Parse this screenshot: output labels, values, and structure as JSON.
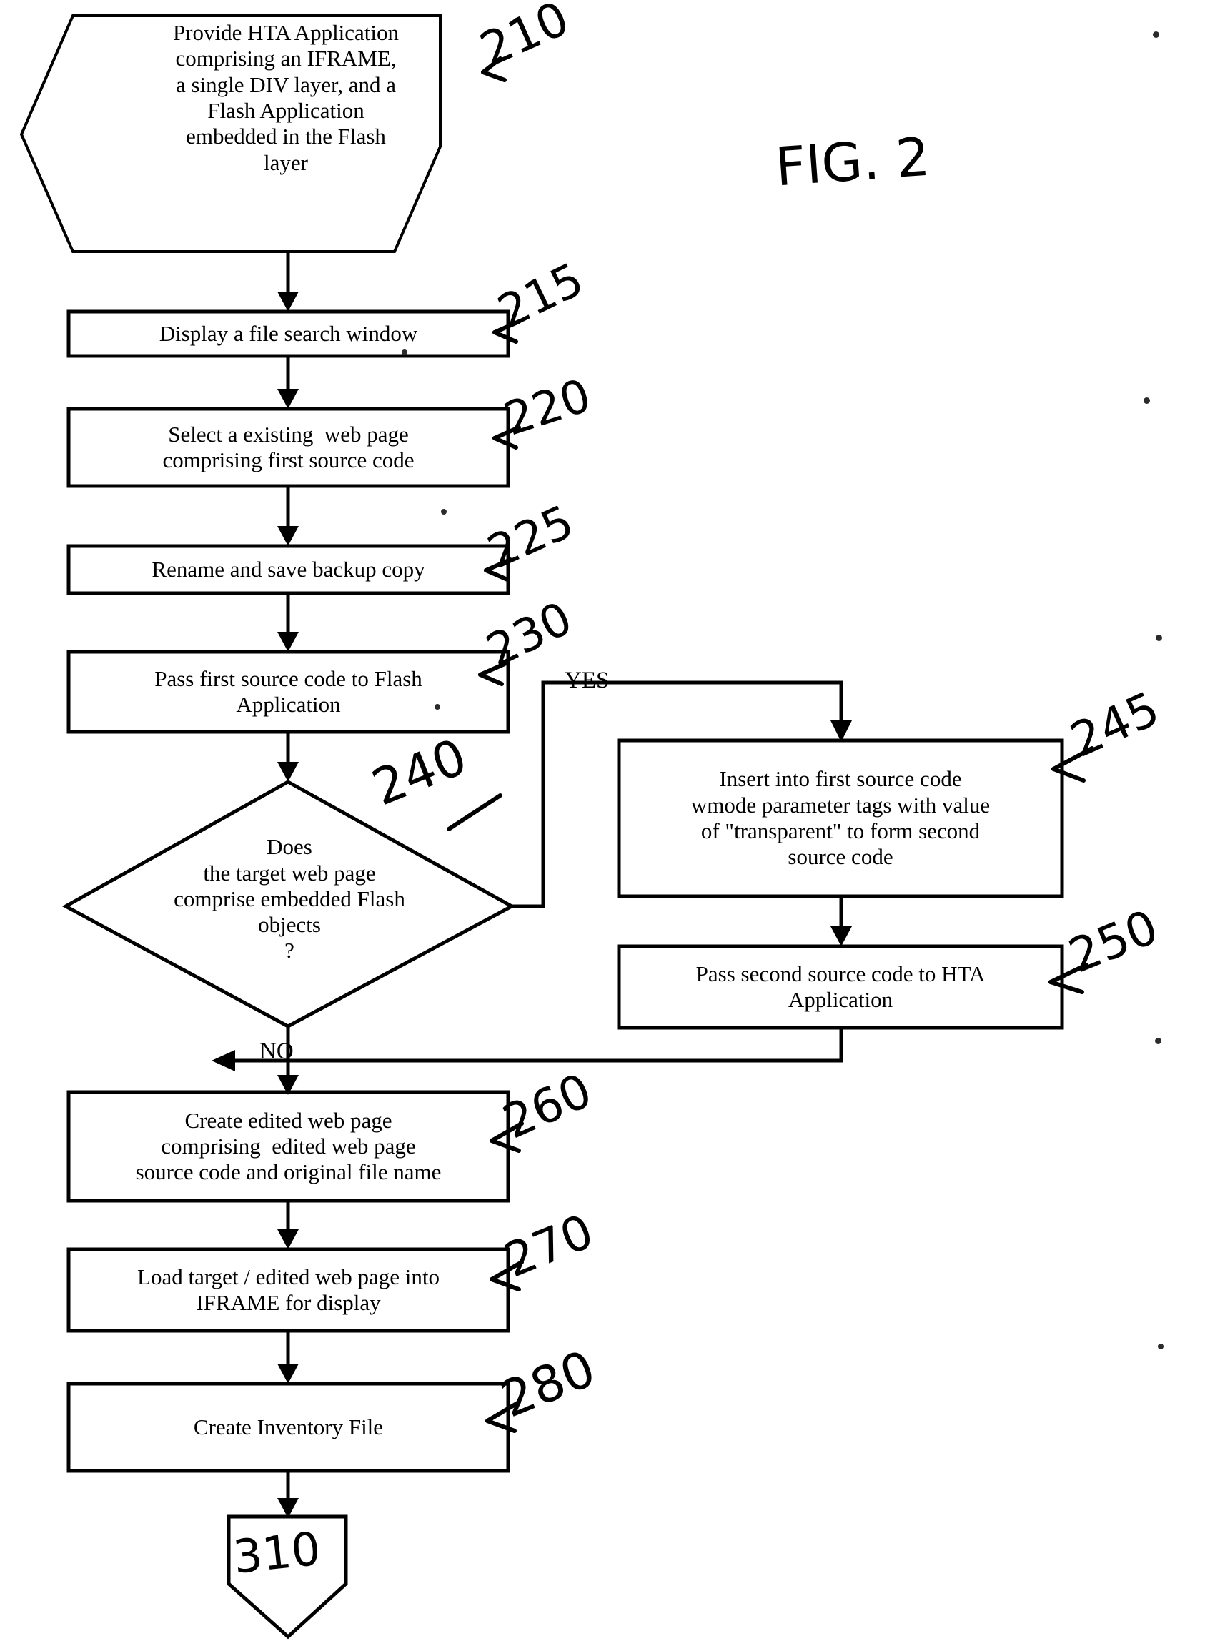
{
  "figure": {
    "title": "FIG. 2",
    "type": "patent-flowchart"
  },
  "nodes": [
    {
      "id": "210",
      "shape": "hexagon",
      "ref": "210",
      "lines": [
        "Provide HTA Application",
        "comprising an IFRAME,",
        "a single DIV layer, and a",
        "Flash Application",
        "embedded in the Flash",
        "layer"
      ]
    },
    {
      "id": "215",
      "shape": "process",
      "ref": "215",
      "lines": [
        "Display a file search window"
      ]
    },
    {
      "id": "220",
      "shape": "process",
      "ref": "220",
      "lines": [
        "Select a existing  web page",
        "comprising first source code"
      ]
    },
    {
      "id": "225",
      "shape": "process",
      "ref": "225",
      "lines": [
        "Rename and save backup copy"
      ]
    },
    {
      "id": "230",
      "shape": "process",
      "ref": "230",
      "lines": [
        "Pass first source code to Flash",
        "Application"
      ]
    },
    {
      "id": "240",
      "shape": "decision",
      "ref": "240",
      "lines": [
        "Does",
        "the target web page",
        "comprise embedded Flash",
        "objects",
        "?"
      ]
    },
    {
      "id": "245",
      "shape": "process",
      "ref": "245",
      "lines": [
        "Insert into first source code",
        "wmode parameter tags with value",
        "of \"transparent\" to form second",
        "source code"
      ]
    },
    {
      "id": "250",
      "shape": "process",
      "ref": "250",
      "lines": [
        "Pass second source code to HTA",
        "Application"
      ]
    },
    {
      "id": "260",
      "shape": "process",
      "ref": "260",
      "lines": [
        "Create edited web page",
        "comprising  edited web page",
        "source code and original file name"
      ]
    },
    {
      "id": "270",
      "shape": "process",
      "ref": "270",
      "lines": [
        "Load target / edited web page into",
        "IFRAME for display"
      ]
    },
    {
      "id": "280",
      "shape": "process",
      "ref": "280",
      "lines": [
        "Create Inventory File"
      ]
    },
    {
      "id": "310",
      "shape": "terminator",
      "ref": "310",
      "lines": []
    }
  ],
  "branch_labels": {
    "yes": "YES",
    "no": "NO"
  },
  "refs": {
    "n210": "210",
    "n215": "215",
    "n220": "220",
    "n225": "225",
    "n230": "230",
    "n240": "240",
    "n245": "245",
    "n250": "250",
    "n260": "260",
    "n270": "270",
    "n280": "280",
    "n310": "310"
  },
  "text": {
    "hex210_l1": "Provide HTA Application",
    "hex210_l2": "comprising an IFRAME,",
    "hex210_l3": "a single DIV layer, and a",
    "hex210_l4": "Flash Application",
    "hex210_l5": "embedded in the Flash",
    "hex210_l6": "layer",
    "b215_l1": "Display a file search window",
    "b220_l1": "Select a existing  web page",
    "b220_l2": "comprising first source code",
    "b225_l1": "Rename and save backup copy",
    "b230_l1": "Pass first source code to Flash",
    "b230_l2": "Application",
    "d240_l1": "Does",
    "d240_l2": "the target web page",
    "d240_l3": "comprise embedded Flash",
    "d240_l4": "objects",
    "d240_l5": "?",
    "b245_l1": "Insert into first source code",
    "b245_l2": "wmode parameter tags with value",
    "b245_l3": "of \"transparent\" to form second",
    "b245_l4": "source code",
    "b250_l1": "Pass second source code to HTA",
    "b250_l2": "Application",
    "b260_l1": "Create edited web page",
    "b260_l2": "comprising  edited web page",
    "b260_l3": "source code and original file name",
    "b270_l1": "Load target / edited web page into",
    "b270_l2": "IFRAME for display",
    "b280_l1": "Create Inventory File",
    "yes": "YES",
    "no": "NO",
    "fig": "FIG. 2"
  },
  "colors": {
    "ink": "#000000",
    "background": "#ffffff"
  }
}
